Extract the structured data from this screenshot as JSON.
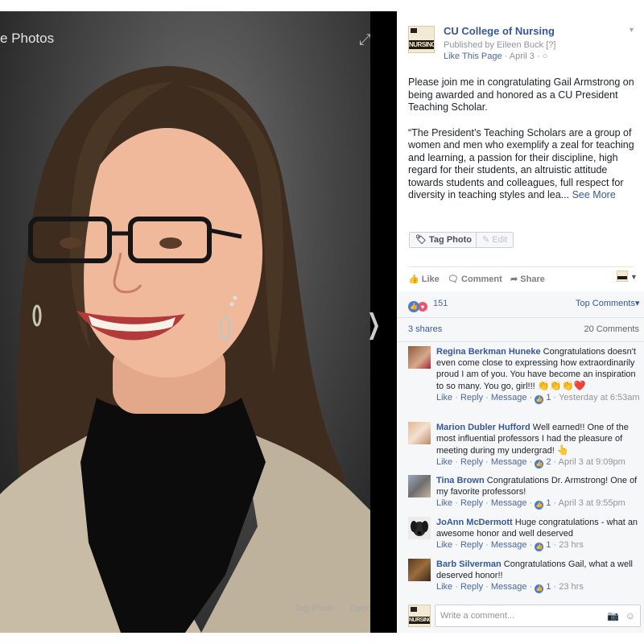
{
  "viewer": {
    "title_fragment": "e Photos",
    "tag_photo": "Tag Photo",
    "options": "Options"
  },
  "post": {
    "page_name": "CU College of Nursing",
    "logo_text": "NURSING",
    "published_by": "Published by Eileen Buck [?]",
    "like_page": "Like This Page",
    "date_sep": " · April 3 · ",
    "globe": "○",
    "paragraph1": "Please join me in congratulating Gail Armstrong on being awarded and honored as a CU President Teaching Scholar.",
    "paragraph2": "“The President’s Teaching Scholars are a group of women and men who exemplify a zeal for teaching and learning, a passion for their discipline, high regard for their students, an altruistic attitude towards students and colleagues, full respect for diversity in teaching styles and lea... ",
    "see_more": "See More",
    "tag_photo_chip": "Tag Photo",
    "edit_chip": "Edit"
  },
  "actions": {
    "like": "Like",
    "comment": "Comment",
    "share": "Share"
  },
  "social": {
    "reaction_count": "151",
    "top_comments": "Top Comments",
    "shares": "3 shares",
    "comments_count": "20 Comments"
  },
  "comments": [
    {
      "name": "Regina Berkman Huneke",
      "text": " Congratulations doesn't even come close to expressing how extraordinarily proud I am of you. You have become an inspiration to so many. You go, girl!!! ",
      "emoji": "👏👏👏❤️",
      "likes": "1",
      "time": "Yesterday at 6:53am"
    },
    {
      "name": "Marion Dubler Hufford",
      "text": " Well earned!! One of the most influential professors I had the pleasure of meeting during my undergrad! ",
      "emoji": "👆",
      "likes": "2",
      "time": "April 3 at 9:09pm"
    },
    {
      "name": "Tina Brown",
      "text": " Congratulations Dr. Armstrong! One of my favorite professors!",
      "emoji": "",
      "likes": "1",
      "time": "April 3 at 9:55pm"
    },
    {
      "name": "JoAnn McDermott",
      "text": " Huge congratulations - what an awesome honor and well deserved",
      "emoji": "",
      "likes": "1",
      "time": "23 hrs"
    },
    {
      "name": "Barb Silverman",
      "text": " Congratulations Gail, what a well deserved honor!!",
      "emoji": "",
      "likes": "1",
      "time": "23 hrs"
    }
  ],
  "comment_actions": {
    "like": "Like",
    "reply": "Reply",
    "message": "Message",
    "sep": " · "
  },
  "composer": {
    "placeholder": "Write a comment..."
  }
}
